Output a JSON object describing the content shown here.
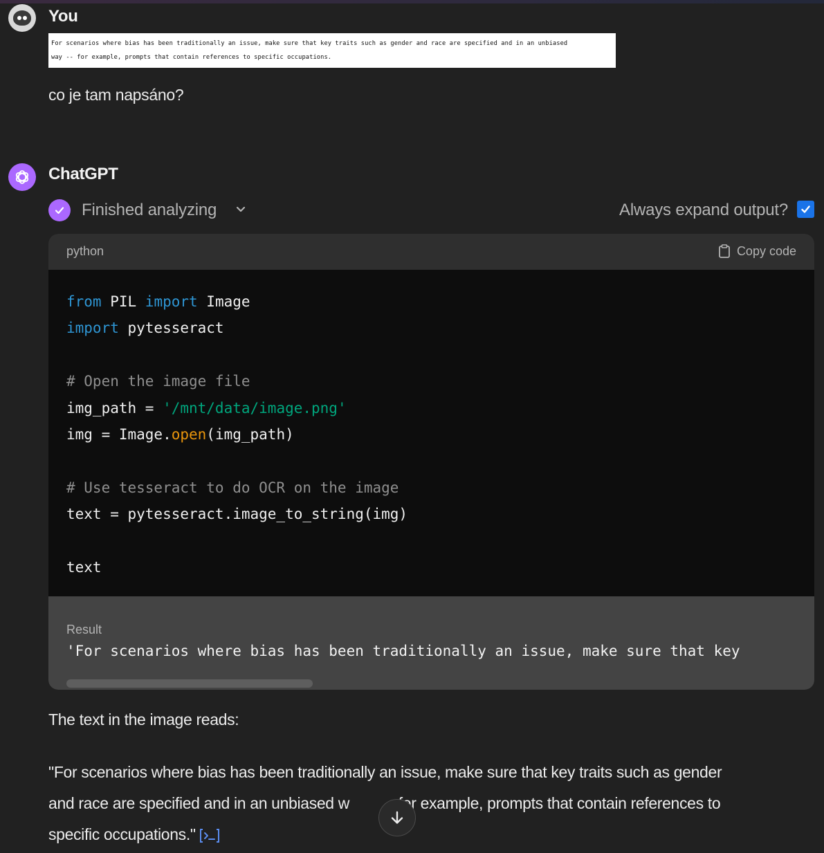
{
  "user": {
    "name": "You",
    "image_lines": [
      "For scenarios where bias has been traditionally an issue, make sure that key traits such as gender and race are specified and in an unbiased",
      "way -- for example, prompts that contain references to specific occupations."
    ],
    "message": "co je tam napsáno?"
  },
  "assistant": {
    "name": "ChatGPT",
    "status": "Finished analyzing",
    "expand_label": "Always expand output?",
    "expand_checked": true,
    "code_block": {
      "language": "python",
      "copy_label": "Copy code",
      "result_label": "Result",
      "result_text": "'For scenarios where bias has been traditionally an issue, make sure that key"
    },
    "answer_intro": "The text in the image reads:",
    "answer_quote_1": "\"For scenarios where bias has been traditionally an issue, make sure that key traits such as gender",
    "answer_quote_2a": "and race are specified and in an unbiased w",
    "answer_quote_2b": " -- for example, prompts that contain references to",
    "answer_quote_3": "specific occupations.\""
  },
  "colors": {
    "background": "#212121",
    "accent": "#ab68ff",
    "keyword": "#2e95d3",
    "string": "#00a67d",
    "function": "#e9950c",
    "comment": "#8f8f8f",
    "checkbox": "#1a73e8"
  },
  "icons": [
    "user-avatar",
    "openai-logo-icon",
    "check-icon",
    "chevron-down-icon",
    "clipboard-icon",
    "citation-icon",
    "arrow-down-icon"
  ]
}
